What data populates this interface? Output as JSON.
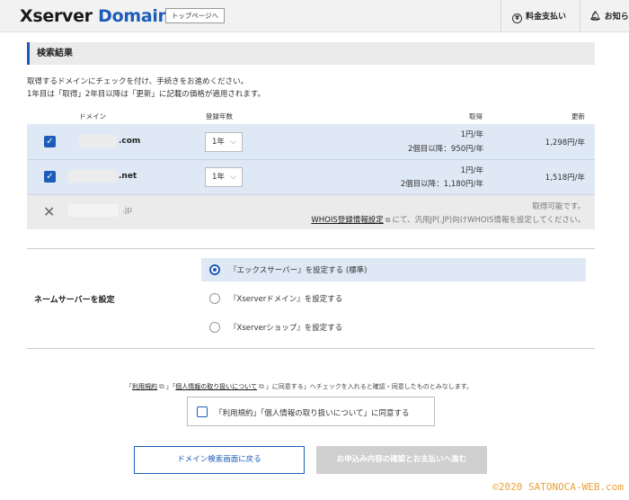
{
  "header": {
    "logo_word1": "Xserver",
    "logo_word2": "Domain",
    "top_page_button": "トップページへ",
    "billing_label": "料金支払い",
    "notice_label": "お知ら"
  },
  "section_title": "検索結果",
  "description": {
    "line1": "取得するドメインにチェックを付け、手続きをお進めください。",
    "line2": "1年目は「取得」2年目以降は「更新」に記載の価格が適用されます。"
  },
  "table": {
    "headers": {
      "domain": "ドメイン",
      "years": "登録年数",
      "acquire": "取得",
      "renew": "更新"
    },
    "rows": [
      {
        "tld": ".com",
        "year": "1年",
        "acquire_line1": "1円/年",
        "acquire_line2": "2個目以降：950円/年",
        "renew": "1,298円/年"
      },
      {
        "tld": ".net",
        "year": "1年",
        "acquire_line1": "1円/年",
        "acquire_line2": "2個目以降：1,180円/年",
        "renew": "1,518円/年"
      },
      {
        "tld": ".jp",
        "status_line1": "取得可能です。",
        "whois_link": "WHOIS登録情報設定",
        "status_line2_rest": "にて、汎用JP(.JP)向けWHOIS情報を設定してください。"
      }
    ]
  },
  "nameserver": {
    "label": "ネームサーバーを設定",
    "options": [
      "『エックスサーバー』を設定する (標準)",
      "『Xserverドメイン』を設定する",
      "『Xserverショップ』を設定する"
    ]
  },
  "agreement": {
    "note_prefix": "「",
    "terms_link": "利用規約",
    "note_mid": "」「",
    "privacy_link": "個人情報の取り扱いについて",
    "note_suffix": "」に同意する」へチェックを入れると確認・同意したものとみなします。",
    "checkbox_label": "「利用規約」「個人情報の取り扱いについて」に同意する"
  },
  "buttons": {
    "back": "ドメイン検索画面に戻る",
    "next": "お申込み内容の確認とお支払いへ進む"
  },
  "watermark": "©2020 SATONOCA-WEB.com",
  "colors": {
    "accent": "#1d5cb8",
    "selected_row": "#dfe9f6",
    "disabled_row": "#ebebeb",
    "watermark": "#e8a13a"
  }
}
